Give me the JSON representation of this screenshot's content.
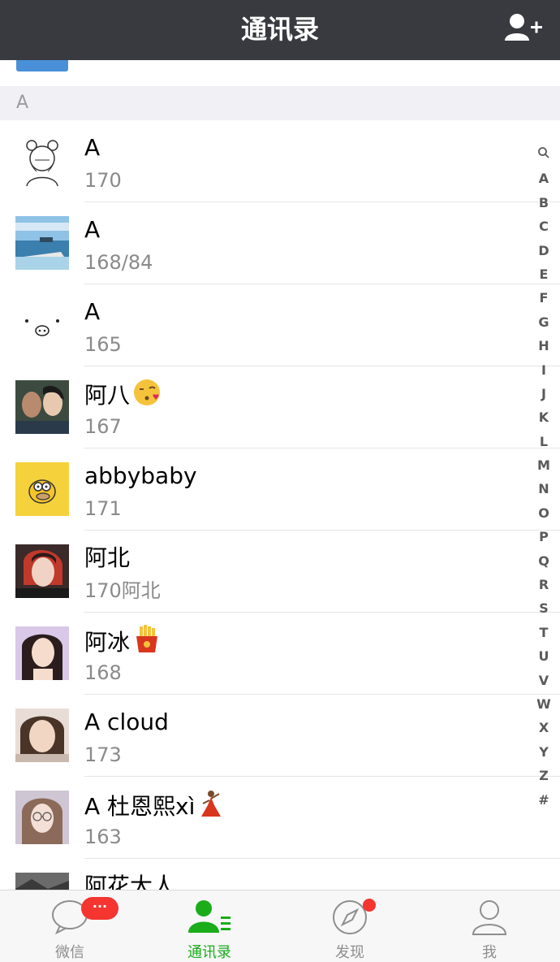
{
  "header": {
    "title": "通讯录",
    "add_icon": "add-contact-icon"
  },
  "section": {
    "letter": "A"
  },
  "contacts": [
    {
      "name": "A",
      "sub": "170",
      "avatar": "sketch-girl-avatar"
    },
    {
      "name": "A",
      "sub": "168/84",
      "avatar": "seaside-photo-avatar"
    },
    {
      "name": "A",
      "sub": "165",
      "avatar": "pig-face-avatar"
    },
    {
      "name": "阿八",
      "sub": "167",
      "avatar": "couple-photo-avatar",
      "emoji": "kissing-face"
    },
    {
      "name": "abbybaby",
      "sub": "171",
      "avatar": "cartoon-yellow-avatar"
    },
    {
      "name": "阿北",
      "sub": "170阿北",
      "avatar": "portrait-red-hair-avatar"
    },
    {
      "name": "阿冰",
      "sub": "168",
      "avatar": "portrait-woman-avatar",
      "emoji": "french-fries"
    },
    {
      "name": "A cloud",
      "sub": "173",
      "avatar": "selfie-avatar"
    },
    {
      "name": "A 杜恩熙xì",
      "sub": "163",
      "avatar": "portrait-glasses-avatar",
      "emoji": "dancer"
    },
    {
      "name": "阿花大人",
      "sub": "",
      "avatar": "dark-photo-avatar"
    }
  ],
  "index_bar": [
    "A",
    "B",
    "C",
    "D",
    "E",
    "F",
    "G",
    "H",
    "I",
    "J",
    "K",
    "L",
    "M",
    "N",
    "O",
    "P",
    "Q",
    "R",
    "S",
    "T",
    "U",
    "V",
    "W",
    "X",
    "Y",
    "Z",
    "#"
  ],
  "tabs": [
    {
      "label": "微信",
      "icon": "chat-bubble-icon",
      "badge": "···"
    },
    {
      "label": "通讯录",
      "icon": "contacts-icon",
      "active": true
    },
    {
      "label": "发现",
      "icon": "compass-icon",
      "dot": true
    },
    {
      "label": "我",
      "icon": "person-icon"
    }
  ],
  "colors": {
    "header_bg": "#393a3f",
    "active_green": "#1aad19",
    "badge_red": "#f43530"
  }
}
